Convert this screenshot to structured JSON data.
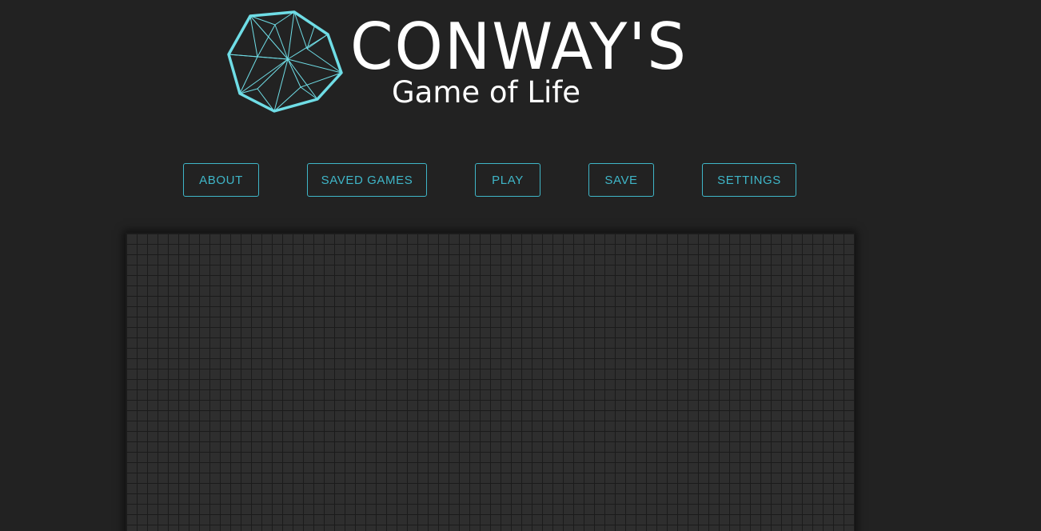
{
  "header": {
    "title": "CONWAY'S",
    "subtitle": "Game of Life",
    "logo_icon": "polygon-wireframe-icon"
  },
  "nav": {
    "about_label": "ABOUT",
    "saved_games_label": "SAVED GAMES",
    "play_label": "PLAY",
    "save_label": "SAVE",
    "settings_label": "SETTINGS"
  },
  "colors": {
    "background": "#222222",
    "accent": "#3fb6c8",
    "logo_outline": "#6fdde6",
    "board_cell": "#2e2e2e",
    "board_grid": "#1b1b1b",
    "title_text": "#ffffff"
  }
}
